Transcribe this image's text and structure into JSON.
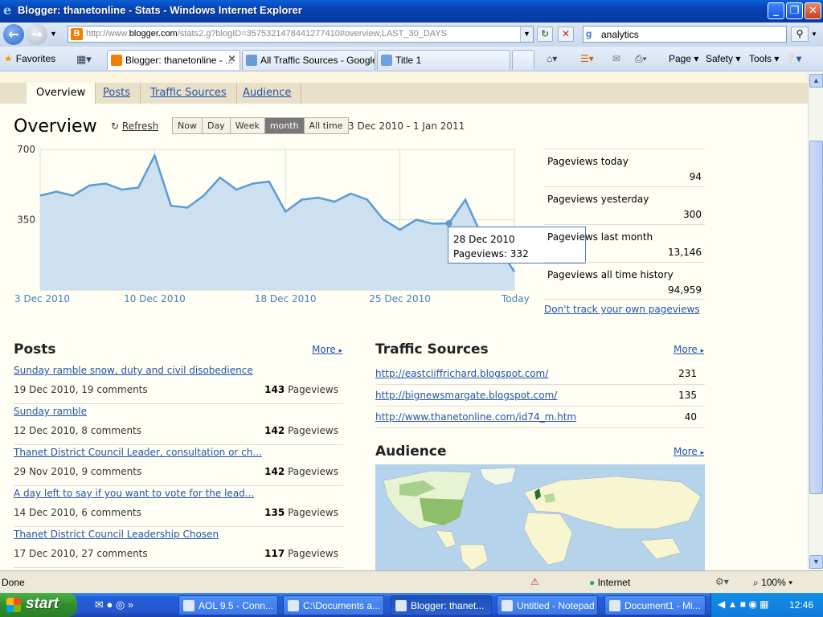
{
  "window": {
    "title": "Blogger: thanetonline - Stats - Windows Internet Explorer",
    "minimize": "_",
    "maximize": "❐",
    "close": "✕"
  },
  "address": {
    "url_prefix": "http://www.",
    "url_domain": "blogger.com",
    "url_rest": "/stats2.g?blogID=3575321478441277410#overview,LAST_30_DAYS",
    "search_query": "analytics"
  },
  "favorites_label": "Favorites",
  "tabs": [
    {
      "label": "Blogger: thanetonline - ...",
      "active": true
    },
    {
      "label": "All Traffic Sources - Google...",
      "active": false
    },
    {
      "label": "Title 1",
      "active": false
    }
  ],
  "command_bar": {
    "page": "Page",
    "safety": "Safety",
    "tools": "Tools"
  },
  "nav_tabs": [
    "Overview",
    "Posts",
    "Traffic Sources",
    "Audience"
  ],
  "overview": {
    "title": "Overview",
    "refresh": "Refresh",
    "ranges": [
      "Now",
      "Day",
      "Week",
      "month",
      "All time"
    ],
    "selected_range": "month",
    "date_range": "3 Dec 2010 - 1 Jan 2011"
  },
  "chart_data": {
    "type": "area",
    "y_ticks": [
      700,
      350
    ],
    "ylim": [
      0,
      700
    ],
    "x_tick_labels": [
      "3 Dec 2010",
      "10 Dec 2010",
      "18 Dec 2010",
      "25 Dec 2010",
      "Today"
    ],
    "x": [
      "3 Dec",
      "4 Dec",
      "5 Dec",
      "6 Dec",
      "7 Dec",
      "8 Dec",
      "9 Dec",
      "10 Dec",
      "11 Dec",
      "12 Dec",
      "13 Dec",
      "14 Dec",
      "15 Dec",
      "16 Dec",
      "17 Dec",
      "18 Dec",
      "19 Dec",
      "20 Dec",
      "21 Dec",
      "22 Dec",
      "23 Dec",
      "24 Dec",
      "25 Dec",
      "26 Dec",
      "27 Dec",
      "28 Dec",
      "29 Dec",
      "30 Dec",
      "31 Dec",
      "1 Jan"
    ],
    "values": [
      470,
      490,
      470,
      520,
      530,
      500,
      510,
      670,
      420,
      410,
      470,
      560,
      500,
      530,
      540,
      390,
      450,
      460,
      440,
      480,
      450,
      350,
      300,
      350,
      330,
      332,
      450,
      270,
      220,
      90
    ],
    "color": "#5b9bd5",
    "fill": "#cde0f0",
    "tooltip": {
      "date": "28 Dec 2010",
      "text": "Pageviews: 332",
      "index": 25
    }
  },
  "stats": [
    {
      "label": "Pageviews today",
      "value": "94"
    },
    {
      "label": "Pageviews yesterday",
      "value": "300"
    },
    {
      "label": "Pageviews last month",
      "value": "13,146"
    },
    {
      "label": "Pageviews all time history",
      "value": "94,959"
    }
  ],
  "dont_track": "Don't track your own pageviews",
  "posts": {
    "title": "Posts",
    "more": "More",
    "items": [
      {
        "title": "Sunday ramble snow, duty and civil disobedience",
        "meta": "19 Dec 2010, 19 comments",
        "views": "143",
        "unit": "Pageviews"
      },
      {
        "title": "Sunday ramble",
        "meta": "12 Dec 2010, 8 comments",
        "views": "142",
        "unit": "Pageviews"
      },
      {
        "title": "Thanet District Council Leader, consultation or ch...",
        "meta": "29 Nov 2010, 9 comments",
        "views": "142",
        "unit": "Pageviews"
      },
      {
        "title": "A day left to say if you want to vote for the lead...",
        "meta": "14 Dec 2010, 6 comments",
        "views": "135",
        "unit": "Pageviews"
      },
      {
        "title": "Thanet District Council Leadership Chosen",
        "meta": "17 Dec 2010, 27 comments",
        "views": "117",
        "unit": "Pageviews"
      }
    ]
  },
  "traffic_sources": {
    "title": "Traffic Sources",
    "more": "More",
    "items": [
      {
        "url": "http://eastcliffrichard.blogspot.com/",
        "count": "231"
      },
      {
        "url": "http://bignewsmargate.blogspot.com/",
        "count": "135"
      },
      {
        "url": "http://www.thanetonline.com/id74_m.htm",
        "count": "40"
      }
    ]
  },
  "audience": {
    "title": "Audience",
    "more": "More"
  },
  "statusbar": {
    "status": "Done",
    "zone": "Internet",
    "zoom": "100%"
  },
  "taskbar": {
    "start": "start",
    "tasks": [
      {
        "label": "AOL 9.5 - Conn...",
        "active": false
      },
      {
        "label": "C:\\Documents a...",
        "active": false
      },
      {
        "label": "Blogger: thanet...",
        "active": true
      },
      {
        "label": "Untitled - Notepad",
        "active": false
      },
      {
        "label": "Document1 - Mi...",
        "active": false
      }
    ],
    "clock": "12:46"
  }
}
